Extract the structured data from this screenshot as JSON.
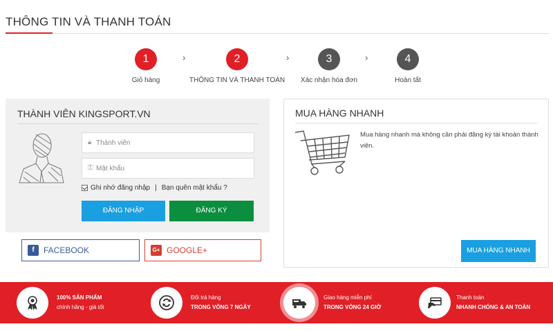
{
  "page": {
    "title": "THÔNG TIN VÀ THANH TOÁN"
  },
  "steps": [
    {
      "num": "1",
      "label": "Giỏ hàng",
      "state": "active"
    },
    {
      "num": "2",
      "label": "THÔNG TIN VÀ THANH TOÁN",
      "state": "active"
    },
    {
      "num": "3",
      "label": "Xác nhận hóa đơn",
      "state": "inactive"
    },
    {
      "num": "4",
      "label": "Hoàn tất",
      "state": "inactive"
    }
  ],
  "member": {
    "title": "THÀNH VIÊN KINGSPORT.VN",
    "username_placeholder": "Thành viên",
    "password_placeholder": "Mật khẩu",
    "remember_label": "Ghi nhớ đăng nhập",
    "separator": "|",
    "forgot_label": "Bạn quên mật khẩu ?",
    "login_label": "ĐĂNG NHẬP",
    "register_label": "ĐĂNG KÝ"
  },
  "social": {
    "facebook_label": "FACEBOOK",
    "google_label": "GOOGLE+",
    "facebook_icon_glyph": "f",
    "google_icon_glyph": "G+"
  },
  "quick": {
    "title": "MUA HÀNG NHANH",
    "description": "Mua hàng nhanh mà không cần phải đăng ký tài khoản thành viên.",
    "button_label": "MUA HÀNG NHANH"
  },
  "features": [
    {
      "line1": "100% SẢN PHẨM",
      "line2": "chính hãng - giá tốt",
      "icon": "medal-icon"
    },
    {
      "line1": "Đổi trả hàng",
      "line2": "TRONG VÒNG 7 NGÀY",
      "icon": "exchange-icon"
    },
    {
      "line1": "Giao hàng miễn phí",
      "line2": "TRONG VÒNG 24 GIỜ",
      "icon": "truck-icon"
    },
    {
      "line1": "Thanh toán",
      "line2": "NHANH CHÓNG & AN TOÀN",
      "icon": "card-icon"
    }
  ],
  "colors": {
    "accent": "#e11f26",
    "primary_button": "#1a9fe0",
    "register_button": "#0b8e3e",
    "facebook": "#3b5998",
    "google": "#d23f31"
  }
}
